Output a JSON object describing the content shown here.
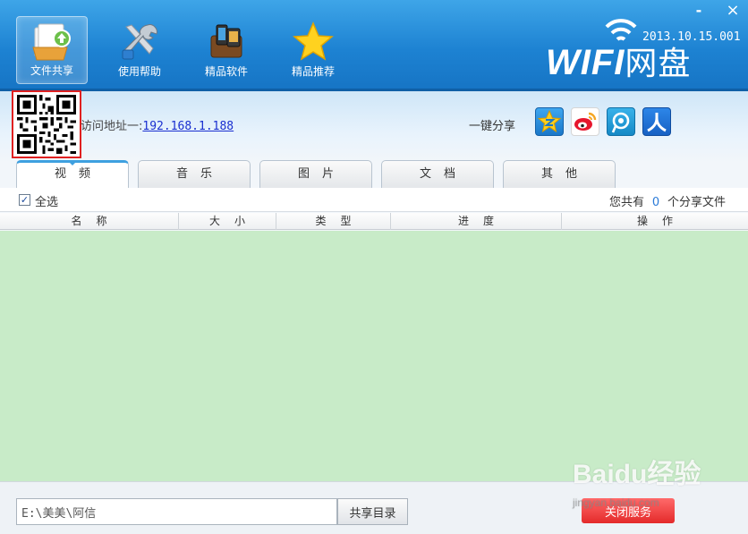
{
  "window": {
    "minimize_label": "-",
    "close_label": "×"
  },
  "toolbar": {
    "items": [
      {
        "label": "文件共享",
        "icon": "file-share-icon",
        "active": true
      },
      {
        "label": "使用帮助",
        "icon": "tools-icon",
        "active": false
      },
      {
        "label": "精品软件",
        "icon": "apps-icon",
        "active": false
      },
      {
        "label": "精品推荐",
        "icon": "star-icon",
        "active": false
      }
    ]
  },
  "brand": {
    "logo_latin": "WIFI",
    "logo_cn": "网盘",
    "version": "2013.10.15.001"
  },
  "access": {
    "label": "访问地址一:",
    "address": "192.168.1.188"
  },
  "share": {
    "label": "一键分享",
    "services": [
      {
        "icon": "qzone-icon",
        "color": "#f6b21b"
      },
      {
        "icon": "sina-weibo-icon",
        "color": "#e6162d"
      },
      {
        "icon": "tencent-weibo-icon",
        "color": "#1f9bd7"
      },
      {
        "icon": "renren-icon",
        "color": "#1f6fd6"
      }
    ]
  },
  "tabs": [
    {
      "label": "视频",
      "active": true
    },
    {
      "label": "音乐",
      "active": false
    },
    {
      "label": "图片",
      "active": false
    },
    {
      "label": "文档",
      "active": false
    },
    {
      "label": "其他",
      "active": false
    }
  ],
  "select_all": {
    "label": "全选",
    "checked": true
  },
  "count": {
    "prefix": "您共有",
    "value": "0",
    "suffix": "个分享文件"
  },
  "columns": [
    "名称",
    "大小",
    "类型",
    "进度",
    "操作"
  ],
  "rows": [],
  "footer": {
    "path_value": "E:\\美美\\阿信",
    "share_dir_label": "共享目录",
    "stop_service_label": "关闭服务"
  },
  "watermark": {
    "text": "Baidu经验",
    "sub": "jingyan.baidu.com"
  },
  "colors": {
    "header": "#1d82d2",
    "list_bg": "#c8ebc8",
    "tab_accent": "#3ea0e0",
    "stop_button": "#e42a2a"
  }
}
